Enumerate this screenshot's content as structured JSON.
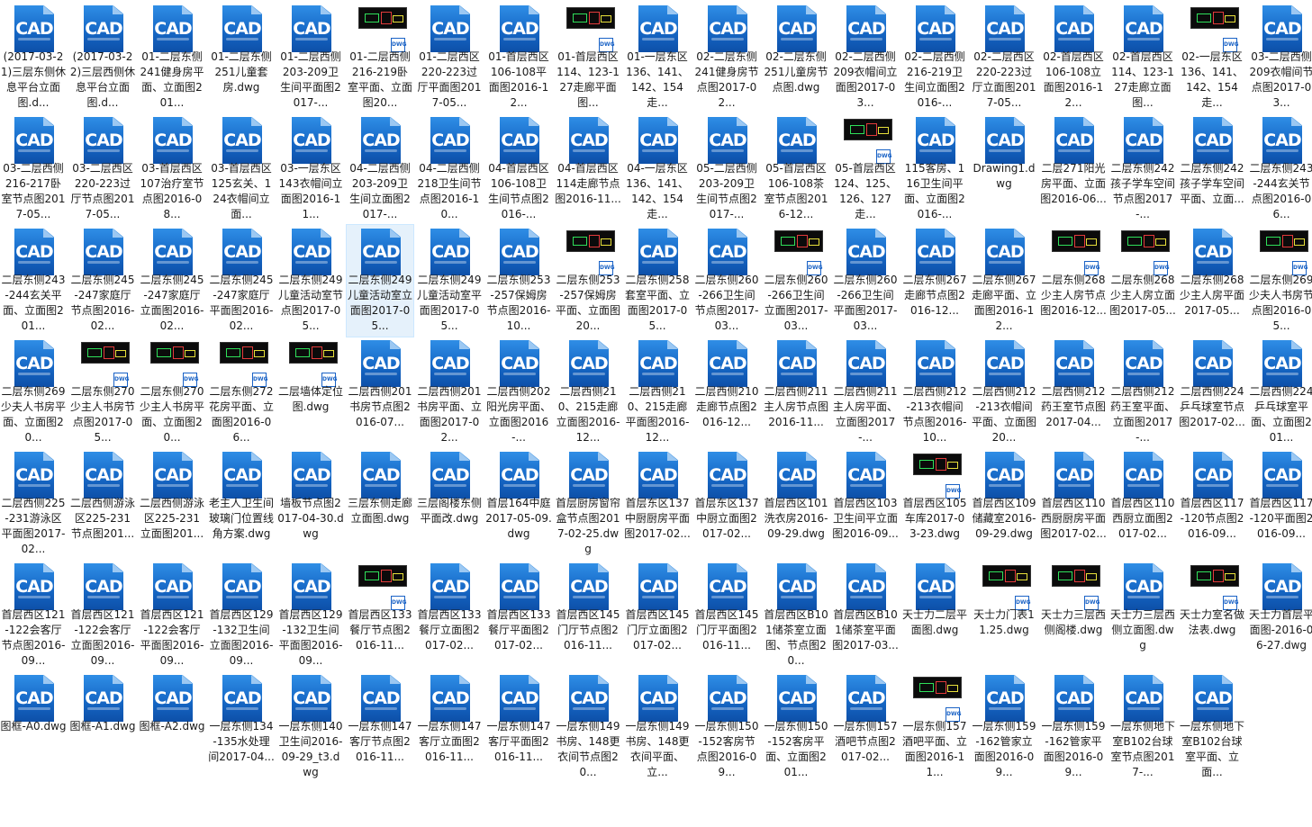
{
  "view": {
    "selected_index": 43,
    "accent": "#1668c6",
    "icon_text": "CAD",
    "preview_badge_text": "DWG"
  },
  "files": [
    {
      "name": "(2017-03-21)三层东侧休息平台立面图.d...",
      "icon": "cad-icon"
    },
    {
      "name": "(2017-03-22)三层西侧休息平台立面图.d...",
      "icon": "cad-icon"
    },
    {
      "name": "01-二层东侧241健身房平面、立面图201...",
      "icon": "cad-icon"
    },
    {
      "name": "01-二层东侧251儿童套房.dwg",
      "icon": "cad-icon"
    },
    {
      "name": "01-二层西侧203-209卫生间平面图2017-...",
      "icon": "cad-icon"
    },
    {
      "name": "01-二层西侧216-219卧室平面、立面图20...",
      "icon": "preview"
    },
    {
      "name": "01-二层西区220-223过厅平面图2017-05...",
      "icon": "cad-icon"
    },
    {
      "name": "01-首层西区106-108平面图2016-12...",
      "icon": "cad-icon"
    },
    {
      "name": "01-首层西区114、123-127走廊平面图...",
      "icon": "preview"
    },
    {
      "name": "01-一层东区136、141、142、154走...",
      "icon": "cad-icon"
    },
    {
      "name": "02-二层东侧241健身房节点图2017-02...",
      "icon": "cad-icon"
    },
    {
      "name": "02-二层东侧251儿童房节点图.dwg",
      "icon": "cad-icon"
    },
    {
      "name": "02-二层西侧209衣帽间立面图2017-03...",
      "icon": "cad-icon"
    },
    {
      "name": "02-二层西侧216-219卫生间立面图2016-...",
      "icon": "cad-icon"
    },
    {
      "name": "02-二层西区220-223过厅立面图2017-05...",
      "icon": "cad-icon"
    },
    {
      "name": "02-首层西区106-108立面图2016-12...",
      "icon": "cad-icon"
    },
    {
      "name": "02-首层西区114、123-127走廊立面图...",
      "icon": "cad-icon"
    },
    {
      "name": "02-一层东区136、141、142、154走...",
      "icon": "preview"
    },
    {
      "name": "03-二层西侧209衣帽间节点图2017-03...",
      "icon": "cad-icon"
    },
    {
      "name": "03-二层西侧216-217卧室节点图2017-05...",
      "icon": "cad-icon"
    },
    {
      "name": "03-二层西区220-223过厅节点图2017-05...",
      "icon": "cad-icon"
    },
    {
      "name": "03-首层西区107治疗室节点图2016-08...",
      "icon": "cad-icon"
    },
    {
      "name": "03-首层西区125玄关、124衣帽间立面...",
      "icon": "cad-icon"
    },
    {
      "name": "03-一层东区143衣帽间立面图2016-11...",
      "icon": "cad-icon"
    },
    {
      "name": "04-二层西侧203-209卫生间立面图2017-...",
      "icon": "cad-icon"
    },
    {
      "name": "04-二层西侧218卫生间节点图2016-10...",
      "icon": "cad-icon"
    },
    {
      "name": "04-首层西区106-108卫生间节点图2016-...",
      "icon": "cad-icon"
    },
    {
      "name": "04-首层西区114走廊节点图2016-11...",
      "icon": "cad-icon"
    },
    {
      "name": "04-一层东区136、141、142、154走...",
      "icon": "cad-icon"
    },
    {
      "name": "05-二层西侧203-209卫生间节点图2017-...",
      "icon": "cad-icon"
    },
    {
      "name": "05-首层西区106-108茶室节点图2016-12...",
      "icon": "cad-icon"
    },
    {
      "name": "05-首层西区124、125、126、127走...",
      "icon": "preview"
    },
    {
      "name": "115客房、116卫生间平面、立面图2016-...",
      "icon": "cad-icon"
    },
    {
      "name": "Drawing1.dwg",
      "icon": "cad-icon"
    },
    {
      "name": "二层271阳光房平面、立面图2016-06...",
      "icon": "cad-icon"
    },
    {
      "name": "二层东侧242孩子学车空间节点图2017-...",
      "icon": "cad-icon"
    },
    {
      "name": "二层东侧242孩子学车空间平面、立面...",
      "icon": "cad-icon"
    },
    {
      "name": "二层东侧243-244玄关节点图2016-06...",
      "icon": "cad-icon"
    },
    {
      "name": "二层东侧243-244玄关平面、立面图201...",
      "icon": "cad-icon"
    },
    {
      "name": "二层东侧245-247家庭厅节点图2016-02...",
      "icon": "cad-icon"
    },
    {
      "name": "二层东侧245-247家庭厅立面图2016-02...",
      "icon": "cad-icon"
    },
    {
      "name": "二层东侧245-247家庭厅平面图2016-02...",
      "icon": "cad-icon"
    },
    {
      "name": "二层东侧249儿童活动室节点图2017-05...",
      "icon": "cad-icon"
    },
    {
      "name": "二层东侧249儿童活动室立面图2017-05...",
      "icon": "cad-icon"
    },
    {
      "name": "二层东侧249儿童活动室平面图2017-05...",
      "icon": "cad-icon"
    },
    {
      "name": "二层东侧253-257保姆房节点图2016-10...",
      "icon": "cad-icon"
    },
    {
      "name": "二层东侧253-257保姆房平面、立面图20...",
      "icon": "preview"
    },
    {
      "name": "二层东侧258套室平面、立面图2017-05...",
      "icon": "cad-icon"
    },
    {
      "name": "二层东侧260-266卫生间节点图2017-03...",
      "icon": "cad-icon"
    },
    {
      "name": "二层东侧260-266卫生间立面图2017-03...",
      "icon": "preview"
    },
    {
      "name": "二层东侧260-266卫生间平面图2017-03...",
      "icon": "cad-icon"
    },
    {
      "name": "二层东侧267走廊节点图2016-12...",
      "icon": "cad-icon"
    },
    {
      "name": "二层东侧267走廊平面、立面图2016-12...",
      "icon": "cad-icon"
    },
    {
      "name": "二层东侧268少主人房节点图2016-12...",
      "icon": "preview"
    },
    {
      "name": "二层东侧268少主人房立面图2017-05...",
      "icon": "preview"
    },
    {
      "name": "二层东侧268少主人房平面2017-05...",
      "icon": "cad-icon"
    },
    {
      "name": "二层东侧269少夫人书房节点图2016-05...",
      "icon": "preview"
    },
    {
      "name": "二层东侧269少夫人书房平面、立面图20...",
      "icon": "cad-icon"
    },
    {
      "name": "二层东侧270少主人书房节点图2017-05...",
      "icon": "preview"
    },
    {
      "name": "二层东侧270少主人书房平面、立面图20...",
      "icon": "preview"
    },
    {
      "name": "二层东侧272花房平面、立面图2016-06...",
      "icon": "preview"
    },
    {
      "name": "二层墙体定位图.dwg",
      "icon": "preview"
    },
    {
      "name": "二层西侧201书房节点图2016-07...",
      "icon": "cad-icon"
    },
    {
      "name": "二层西侧201书房平面、立面图2017-02...",
      "icon": "cad-icon"
    },
    {
      "name": "二层西侧202阳光房平面、立面图2016-...",
      "icon": "cad-icon"
    },
    {
      "name": "二层西侧210、215走廊立面图2016-12...",
      "icon": "cad-icon"
    },
    {
      "name": "二层西侧210、215走廊平面图2016-12...",
      "icon": "cad-icon"
    },
    {
      "name": "二层西侧210走廊节点图2016-12...",
      "icon": "cad-icon"
    },
    {
      "name": "二层西侧211主人房节点图2016-11...",
      "icon": "cad-icon"
    },
    {
      "name": "二层西侧211主人房平面、立面图2017-...",
      "icon": "cad-icon"
    },
    {
      "name": "二层西侧212-213衣帽间节点图2016-10...",
      "icon": "cad-icon"
    },
    {
      "name": "二层西侧212-213衣帽间平面、立面图20...",
      "icon": "cad-icon"
    },
    {
      "name": "二层西侧212药王室节点图2017-04...",
      "icon": "cad-icon"
    },
    {
      "name": "二层西侧212药王室平面、立面图2017-...",
      "icon": "cad-icon"
    },
    {
      "name": "二层西侧224乒乓球室节点图2017-02...",
      "icon": "cad-icon"
    },
    {
      "name": "二层西侧224乒乓球室平面、立面图201...",
      "icon": "cad-icon"
    },
    {
      "name": "二层西侧225-231游泳区平面图2017-02...",
      "icon": "cad-icon"
    },
    {
      "name": "二层西侧游泳区225-231节点图201...",
      "icon": "cad-icon"
    },
    {
      "name": "二层西侧游泳区225-231立面图201...",
      "icon": "cad-icon"
    },
    {
      "name": "老主人卫生间玻璃门位置线角方案.dwg",
      "icon": "cad-icon"
    },
    {
      "name": "墙板节点图2017-04-30.dwg",
      "icon": "cad-icon"
    },
    {
      "name": "三层东侧走廊立面图.dwg",
      "icon": "cad-icon"
    },
    {
      "name": "三层阁楼东侧平面改.dwg",
      "icon": "cad-icon"
    },
    {
      "name": "首层164中庭2017-05-09.dwg",
      "icon": "cad-icon"
    },
    {
      "name": "首层厨房窗帘盒节点图2017-02-25.dwg",
      "icon": "cad-icon"
    },
    {
      "name": "首层东区137中厨厨房平面图2017-02...",
      "icon": "cad-icon"
    },
    {
      "name": "首层东区137中厨立面图2017-02...",
      "icon": "cad-icon"
    },
    {
      "name": "首层西区101洗衣房2016-09-29.dwg",
      "icon": "cad-icon"
    },
    {
      "name": "首层西区103卫生间平立面图2016-09...",
      "icon": "cad-icon"
    },
    {
      "name": "首层西区105车库2017-03-23.dwg",
      "icon": "preview"
    },
    {
      "name": "首层西区109储藏室2016-09-29.dwg",
      "icon": "cad-icon"
    },
    {
      "name": "首层西区110西厨厨房平面图2017-02...",
      "icon": "cad-icon"
    },
    {
      "name": "首层西区110西厨立面图2017-02...",
      "icon": "cad-icon"
    },
    {
      "name": "首层西区117-120节点图2016-09...",
      "icon": "cad-icon"
    },
    {
      "name": "首层西区117-120平面图2016-09...",
      "icon": "cad-icon"
    },
    {
      "name": "首层西区121-122会客厅节点图2016-09...",
      "icon": "cad-icon"
    },
    {
      "name": "首层西区121-122会客厅立面图2016-09...",
      "icon": "cad-icon"
    },
    {
      "name": "首层西区121-122会客厅平面图2016-09...",
      "icon": "cad-icon"
    },
    {
      "name": "首层西区129-132卫生间立面图2016-09...",
      "icon": "cad-icon"
    },
    {
      "name": "首层西区129-132卫生间平面图2016-09...",
      "icon": "cad-icon"
    },
    {
      "name": "首层西区133餐厅节点图2016-11...",
      "icon": "preview"
    },
    {
      "name": "首层西区133餐厅立面图2017-02...",
      "icon": "cad-icon"
    },
    {
      "name": "首层西区133餐厅平面图2017-02...",
      "icon": "cad-icon"
    },
    {
      "name": "首层西区145门厅节点图2016-11...",
      "icon": "cad-icon"
    },
    {
      "name": "首层西区145门厅立面图2017-02...",
      "icon": "cad-icon"
    },
    {
      "name": "首层西区145门厅平面图2016-11...",
      "icon": "cad-icon"
    },
    {
      "name": "首层西区B101储茶室立面图、节点图20...",
      "icon": "cad-icon"
    },
    {
      "name": "首层西区B101储茶室平面图2017-03...",
      "icon": "cad-icon"
    },
    {
      "name": "天士力二层平面图.dwg",
      "icon": "cad-icon"
    },
    {
      "name": "天士力门表11.25.dwg",
      "icon": "preview"
    },
    {
      "name": "天士力三层西侧阁楼.dwg",
      "icon": "preview"
    },
    {
      "name": "天士力三层西侧立面图.dwg",
      "icon": "cad-icon"
    },
    {
      "name": "天士力室名做法表.dwg",
      "icon": "preview"
    },
    {
      "name": "天士力首层平面图-2016-06-27.dwg",
      "icon": "cad-icon"
    },
    {
      "name": "图框-A0.dwg",
      "icon": "cad-icon"
    },
    {
      "name": "图框-A1.dwg",
      "icon": "cad-icon"
    },
    {
      "name": "图框-A2.dwg",
      "icon": "cad-icon"
    },
    {
      "name": "一层东侧134-135水处理间2017-04...",
      "icon": "cad-icon"
    },
    {
      "name": "一层东侧140卫生间2016-09-29_t3.dwg",
      "icon": "cad-icon"
    },
    {
      "name": "一层东侧147客厅节点图2016-11...",
      "icon": "cad-icon"
    },
    {
      "name": "一层东侧147客厅立面图2016-11...",
      "icon": "cad-icon"
    },
    {
      "name": "一层东侧147客厅平面图2016-11...",
      "icon": "cad-icon"
    },
    {
      "name": "一层东侧149书房、148更衣间节点图20...",
      "icon": "cad-icon"
    },
    {
      "name": "一层东侧149书房、148更衣间平面、立...",
      "icon": "cad-icon"
    },
    {
      "name": "一层东侧150-152客房节点图2016-09...",
      "icon": "cad-icon"
    },
    {
      "name": "一层东侧150-152客房平面、立面图201...",
      "icon": "cad-icon"
    },
    {
      "name": "一层东侧157酒吧节点图2017-02...",
      "icon": "cad-icon"
    },
    {
      "name": "一层东侧157酒吧平面、立面图2016-11...",
      "icon": "preview"
    },
    {
      "name": "一层东侧159-162管家立面图2016-09...",
      "icon": "cad-icon"
    },
    {
      "name": "一层东侧159-162管家平面图2016-09...",
      "icon": "cad-icon"
    },
    {
      "name": "一层东侧地下室B102台球室节点图2017-...",
      "icon": "cad-icon"
    },
    {
      "name": "一层东侧地下室B102台球室平面、立面...",
      "icon": "cad-icon"
    }
  ]
}
